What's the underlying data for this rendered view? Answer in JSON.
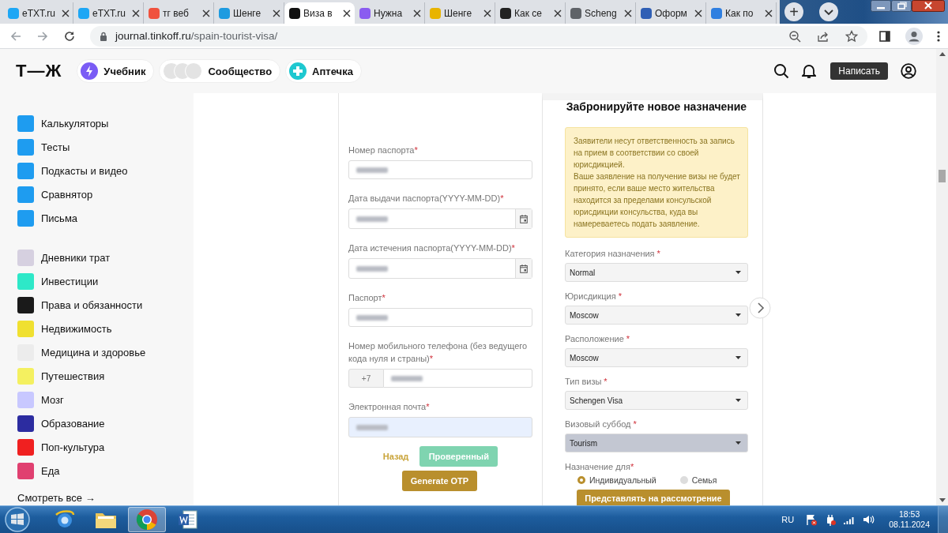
{
  "browser": {
    "tabs": [
      {
        "title": "eTXT.ru",
        "selected": false,
        "color": "#1ea7f5"
      },
      {
        "title": "eTXT.ru",
        "selected": false,
        "color": "#1ea7f5"
      },
      {
        "title": "тг веб",
        "selected": false,
        "color": "#f0523e"
      },
      {
        "title": "Шенге",
        "selected": false,
        "color": "#1e9be0"
      },
      {
        "title": "Виза в",
        "selected": true,
        "color": "#111111"
      },
      {
        "title": "Нужна",
        "selected": false,
        "color": "#8a5cf0"
      },
      {
        "title": "Шенге",
        "selected": false,
        "color": "#e8b400"
      },
      {
        "title": "Как се",
        "selected": false,
        "color": "#222222"
      },
      {
        "title": "Scheng",
        "selected": false,
        "color": "#5f6368"
      },
      {
        "title": "Оформ",
        "selected": false,
        "color": "#2f5fb5"
      },
      {
        "title": "Как по",
        "selected": false,
        "color": "#2f7fe0"
      }
    ],
    "new_tab": "+",
    "address": {
      "host": "journal.tinkoff.ru",
      "path": "/spain-tourist-visa/"
    }
  },
  "header": {
    "logo": "Т—Ж",
    "pills": [
      {
        "label": "Учебник",
        "kind": "bolt"
      },
      {
        "label": "Сообщество",
        "kind": "avatars"
      },
      {
        "label": "Аптечка",
        "kind": "cross"
      }
    ],
    "write_button": "Написать"
  },
  "sidebar": {
    "groups": [
      [
        {
          "label": "Калькуляторы",
          "color": "#1e9cf0"
        },
        {
          "label": "Тесты",
          "color": "#1e9cf0"
        },
        {
          "label": "Подкасты и видео",
          "color": "#1e9cf0"
        },
        {
          "label": "Сравнятор",
          "color": "#1e9cf0"
        },
        {
          "label": "Письма",
          "color": "#1e9cf0"
        }
      ],
      [
        {
          "label": "Дневники трат",
          "color": "#d6d0e0"
        },
        {
          "label": "Инвестиции",
          "color": "#2ee8c8"
        },
        {
          "label": "Права и обязанности",
          "color": "#1a1a1a"
        },
        {
          "label": "Недвижимость",
          "color": "#f0e030"
        },
        {
          "label": "Медицина и здоровье",
          "color": "#ececec"
        },
        {
          "label": "Путешествия",
          "color": "#f4f060"
        },
        {
          "label": "Мозг",
          "color": "#c8c8ff"
        },
        {
          "label": "Образование",
          "color": "#2c2ca0"
        },
        {
          "label": "Поп-культура",
          "color": "#f02020"
        },
        {
          "label": "Еда",
          "color": "#e04070"
        }
      ]
    ],
    "see_all": "Смотреть все →"
  },
  "passport_form": {
    "fields": [
      {
        "label": "Номер паспорта",
        "mark": "*",
        "kind": "text",
        "redacted": true
      },
      {
        "label": "Дата выдачи паспорта(YYYY-MM-DD)",
        "mark": "*",
        "kind": "date",
        "redacted": true
      },
      {
        "label": "Дата истечения паспорта(YYYY-MM-DD)",
        "mark": "*",
        "kind": "date",
        "redacted": true
      },
      {
        "label": "Паспорт",
        "mark": "*",
        "kind": "text",
        "redacted": true
      },
      {
        "label": "Номер мобильного телефона (без ведущего кода нуля и страны)",
        "mark": "*",
        "kind": "phone",
        "prefix": "+7",
        "redacted": true
      },
      {
        "label": "Электронная почта",
        "mark": "*",
        "kind": "email",
        "redacted": true,
        "autofilled": true
      }
    ],
    "back": "Назад",
    "verified": "Проверенный",
    "otp": "Generate OTP"
  },
  "booking_form": {
    "title": "Забронируйте новое назначение",
    "notice": [
      "Заявители несут ответственность за запись на прием в соответствии со своей юрисдикцией.",
      "Ваше заявление на получение визы не будет принято, если ваше место жительства находится за пределами консульской юрисдикции консульства, куда вы намереваетесь подать заявление."
    ],
    "selects": [
      {
        "label": "Категория назначения",
        "mark": "*",
        "value": "Normal",
        "highlighted": false
      },
      {
        "label": "Юрисдикция",
        "mark": "*",
        "value": "Moscow",
        "highlighted": false
      },
      {
        "label": "Расположение",
        "mark": "*",
        "value": "Moscow",
        "highlighted": false
      },
      {
        "label": "Тип визы",
        "mark": "*",
        "value": "Schengen Visa",
        "highlighted": false
      },
      {
        "label": "Визовый суббод",
        "mark": "*",
        "value": "Tourism",
        "highlighted": true
      }
    ],
    "purpose": {
      "label": "Назначение для",
      "mark": "*",
      "options": [
        {
          "label": "Индивидуальный",
          "selected": true
        },
        {
          "label": "Семья",
          "selected": false
        }
      ]
    },
    "submit": "Представлять на рассмотрение"
  },
  "taskbar": {
    "apps": [
      {
        "kind": "ie",
        "selected": false
      },
      {
        "kind": "folder",
        "selected": false
      },
      {
        "kind": "chrome",
        "selected": true
      },
      {
        "kind": "word",
        "selected": false
      }
    ],
    "language": "RU",
    "time": "18:53",
    "date": "08.11.2024"
  }
}
